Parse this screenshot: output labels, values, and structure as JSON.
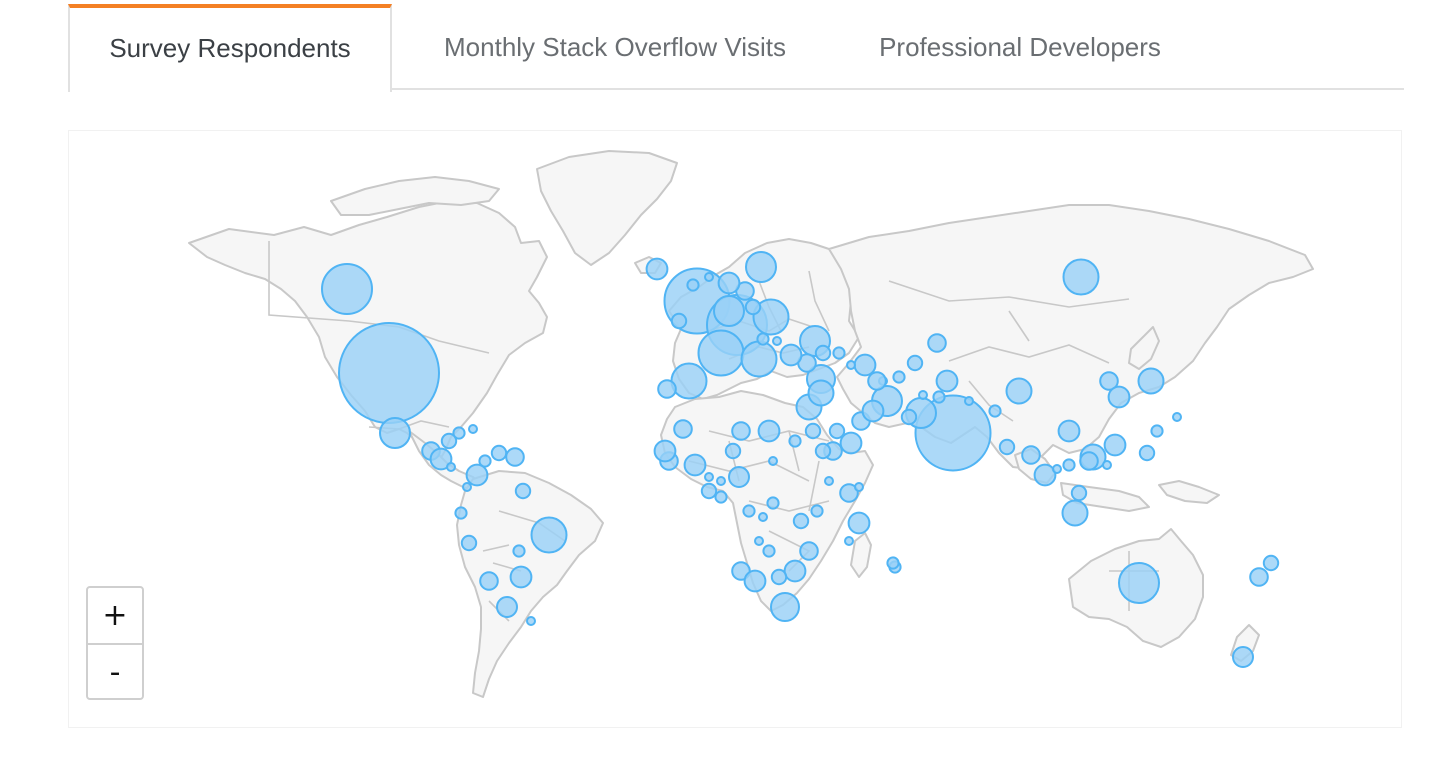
{
  "tabs": [
    {
      "label": "Survey Respondents",
      "active": true
    },
    {
      "label": "Monthly Stack Overflow Visits",
      "active": false
    },
    {
      "label": "Professional Developers",
      "active": false
    }
  ],
  "zoom": {
    "in_label": "+",
    "out_label": "-"
  },
  "colors": {
    "accent": "#f48024",
    "bubble_fill": "#9ad1f7",
    "bubble_stroke": "#50b4f4",
    "land": "#f6f6f6",
    "border": "#c8c8c8"
  },
  "map": {
    "kind": "world bubble map",
    "bubbles": [
      {
        "region": "United States",
        "size": 10
      },
      {
        "region": "Canada",
        "size": 5
      },
      {
        "region": "Mexico",
        "size": 3
      },
      {
        "region": "Brazil",
        "size": 3.5
      },
      {
        "region": "United Kingdom",
        "size": 6.5
      },
      {
        "region": "Germany",
        "size": 6
      },
      {
        "region": "France",
        "size": 4.5
      },
      {
        "region": "India",
        "size": 7.5
      },
      {
        "region": "Russia",
        "size": 3.5
      },
      {
        "region": "Australia",
        "size": 4
      },
      {
        "region": "Spain",
        "size": 3.5
      },
      {
        "region": "Italy",
        "size": 3.5
      },
      {
        "region": "Poland",
        "size": 3.5
      },
      {
        "region": "Netherlands",
        "size": 3
      },
      {
        "region": "Sweden",
        "size": 3
      },
      {
        "region": "Ukraine",
        "size": 3
      },
      {
        "region": "South Africa",
        "size": 2.8
      },
      {
        "region": "China",
        "size": 2.5
      },
      {
        "region": "Japan",
        "size": 2.5
      },
      {
        "region": "Philippines",
        "size": 2.5
      },
      {
        "region": "Indonesia",
        "size": 2.5
      },
      {
        "region": "Argentina",
        "size": 2
      },
      {
        "region": "New Zealand",
        "size": 2
      },
      {
        "region": "Pakistan",
        "size": 3
      },
      {
        "region": "Iran",
        "size": 3
      },
      {
        "region": "Turkey",
        "size": 2.8
      },
      {
        "region": "Egypt",
        "size": 2.5
      },
      {
        "region": "Israel",
        "size": 2.5
      },
      {
        "region": "Nigeria",
        "size": 2
      }
    ]
  }
}
